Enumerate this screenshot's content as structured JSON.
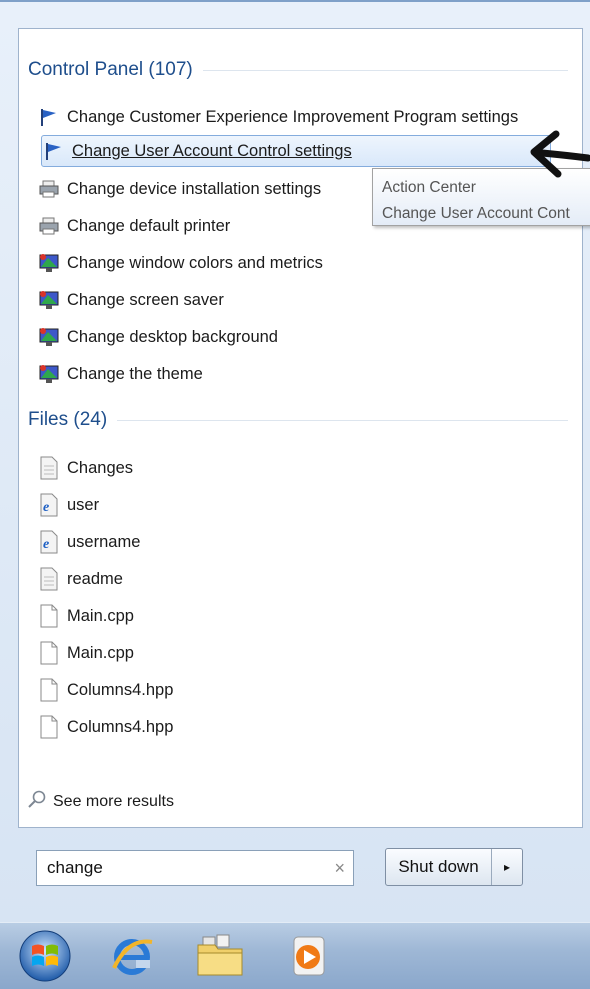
{
  "control_panel": {
    "header": "Control Panel (107)",
    "items": [
      {
        "label": "Change Customer Experience Improvement Program settings",
        "icon": "flag-icon"
      },
      {
        "label": "Change User Account Control settings",
        "icon": "flag-icon"
      },
      {
        "label": "Change device installation settings",
        "icon": "printer-icon"
      },
      {
        "label": "Change default printer",
        "icon": "printer-icon"
      },
      {
        "label": "Change window colors and metrics",
        "icon": "display-icon"
      },
      {
        "label": "Change screen saver",
        "icon": "display-icon"
      },
      {
        "label": "Change desktop background",
        "icon": "display-icon"
      },
      {
        "label": "Change the theme",
        "icon": "display-icon"
      }
    ]
  },
  "tooltip": {
    "line1": "Action Center",
    "line2": "Change User Account Cont"
  },
  "files": {
    "header": "Files (24)",
    "items": [
      {
        "label": "Changes",
        "icon": "document-icon"
      },
      {
        "label": "user",
        "icon": "ie-document-icon"
      },
      {
        "label": "username",
        "icon": "ie-document-icon"
      },
      {
        "label": "readme",
        "icon": "document-icon"
      },
      {
        "label": "Main.cpp",
        "icon": "file-icon"
      },
      {
        "label": "Main.cpp",
        "icon": "file-icon"
      },
      {
        "label": "Columns4.hpp",
        "icon": "file-icon"
      },
      {
        "label": "Columns4.hpp",
        "icon": "file-icon"
      }
    ]
  },
  "see_more": "See more results",
  "search": {
    "value": "change"
  },
  "shutdown": {
    "label": "Shut down"
  },
  "taskbar": [
    "start-orb-icon",
    "internet-explorer-icon",
    "windows-explorer-icon",
    "media-player-icon"
  ],
  "colors": {
    "highlight_border": "#84acdd",
    "header_text": "#1e4e8c"
  }
}
